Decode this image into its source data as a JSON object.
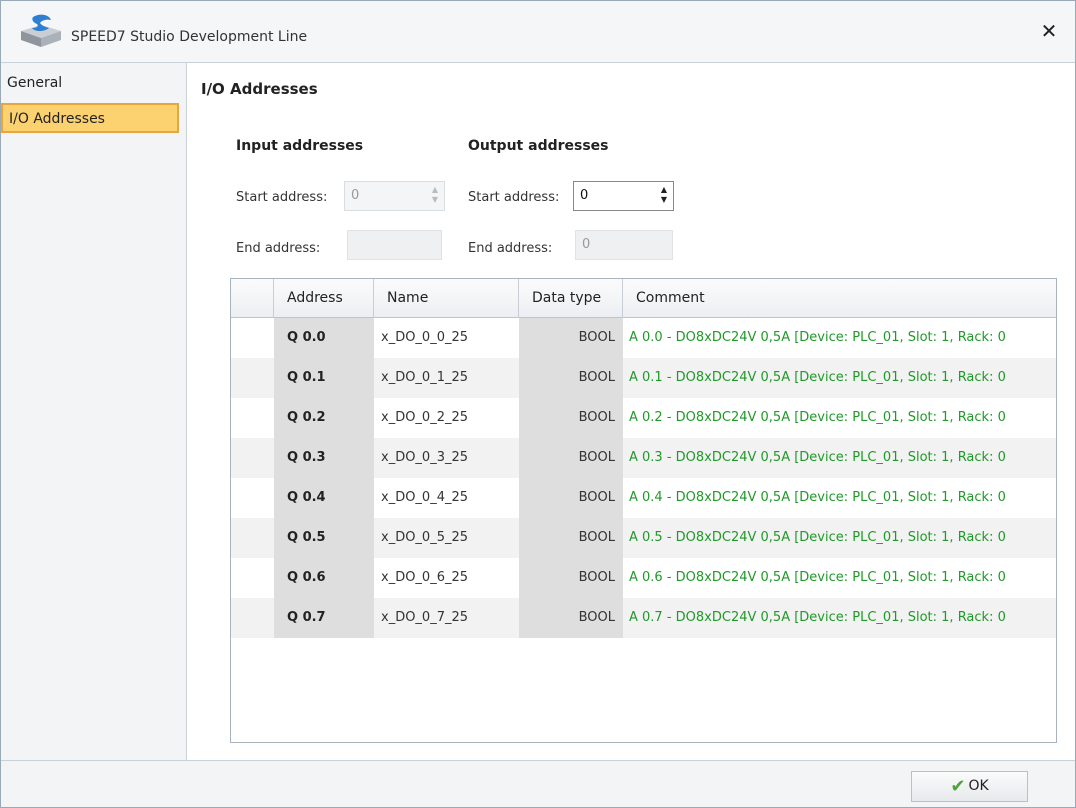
{
  "window": {
    "title": "SPEED7 Studio Development Line"
  },
  "sidebar": {
    "items": [
      {
        "label": "General"
      },
      {
        "label": "I/O Addresses"
      }
    ]
  },
  "page": {
    "title": "I/O Addresses"
  },
  "input": {
    "title": "Input addresses",
    "start_label": "Start address:",
    "start_value": "0",
    "end_label": "End address:",
    "end_value": ""
  },
  "output": {
    "title": "Output addresses",
    "start_label": "Start address:",
    "start_value": "0",
    "end_label": "End address:",
    "end_value": "0"
  },
  "table": {
    "columns": [
      "Address",
      "Name",
      "Data type",
      "Comment"
    ],
    "rows": [
      {
        "address": "Q 0.0",
        "name": "x_DO_0_0_25",
        "type": "BOOL",
        "comment": "A 0.0 - DO8xDC24V 0,5A [Device: PLC_01, Slot: 1, Rack: 0"
      },
      {
        "address": "Q 0.1",
        "name": "x_DO_0_1_25",
        "type": "BOOL",
        "comment": "A 0.1 - DO8xDC24V 0,5A [Device: PLC_01, Slot: 1, Rack: 0"
      },
      {
        "address": "Q 0.2",
        "name": "x_DO_0_2_25",
        "type": "BOOL",
        "comment": "A 0.2 - DO8xDC24V 0,5A [Device: PLC_01, Slot: 1, Rack: 0"
      },
      {
        "address": "Q 0.3",
        "name": "x_DO_0_3_25",
        "type": "BOOL",
        "comment": "A 0.3 - DO8xDC24V 0,5A [Device: PLC_01, Slot: 1, Rack: 0"
      },
      {
        "address": "Q 0.4",
        "name": "x_DO_0_4_25",
        "type": "BOOL",
        "comment": "A 0.4 - DO8xDC24V 0,5A [Device: PLC_01, Slot: 1, Rack: 0"
      },
      {
        "address": "Q 0.5",
        "name": "x_DO_0_5_25",
        "type": "BOOL",
        "comment": "A 0.5 - DO8xDC24V 0,5A [Device: PLC_01, Slot: 1, Rack: 0"
      },
      {
        "address": "Q 0.6",
        "name": "x_DO_0_6_25",
        "type": "BOOL",
        "comment": "A 0.6 - DO8xDC24V 0,5A [Device: PLC_01, Slot: 1, Rack: 0"
      },
      {
        "address": "Q 0.7",
        "name": "x_DO_0_7_25",
        "type": "BOOL",
        "comment": "A 0.7 - DO8xDC24V 0,5A [Device: PLC_01, Slot: 1, Rack: 0"
      }
    ]
  },
  "footer": {
    "ok_label": "OK"
  },
  "icons": {
    "logo": "speed7-logo-icon",
    "close": "close-icon",
    "ok": "check-icon"
  },
  "colors": {
    "accent": "#fcd270",
    "comment_text": "#1f9a27"
  }
}
